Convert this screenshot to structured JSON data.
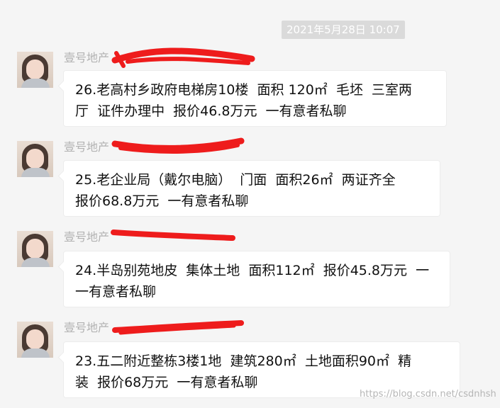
{
  "chat": {
    "timestamp": "2021年5月28日 10:07",
    "messages": [
      {
        "sender": "壹号地产",
        "text": "26.老高村乡政府电梯房10楼  面积 120㎡  毛坯  三室两\n厅  证件办理中  报价46.8万元  一有意者私聊"
      },
      {
        "sender": "壹号地产",
        "text": "25.老企业局（戴尔电脑）  门面  面积26㎡  两证齐全\n报价68.8万元  一有意者私聊"
      },
      {
        "sender": "壹号地产",
        "text": "24.半岛别苑地皮  集体土地  面积112㎡  报价45.8万元  一\n一有意者私聊"
      },
      {
        "sender": "壹号地产",
        "text": "23.五二附近整栋3楼1地  建筑280㎡  土地面积90㎡  精\n装  报价68万元  一有意者私聊"
      }
    ],
    "watermark": "https://blog.csdn.net/csdnhsh"
  },
  "colors": {
    "background": "#f5f5f5",
    "bubble": "#ffffff",
    "timestamp_bg": "#dadada",
    "sender_text": "#b2b2b2",
    "redaction": "#ee1c1c"
  }
}
